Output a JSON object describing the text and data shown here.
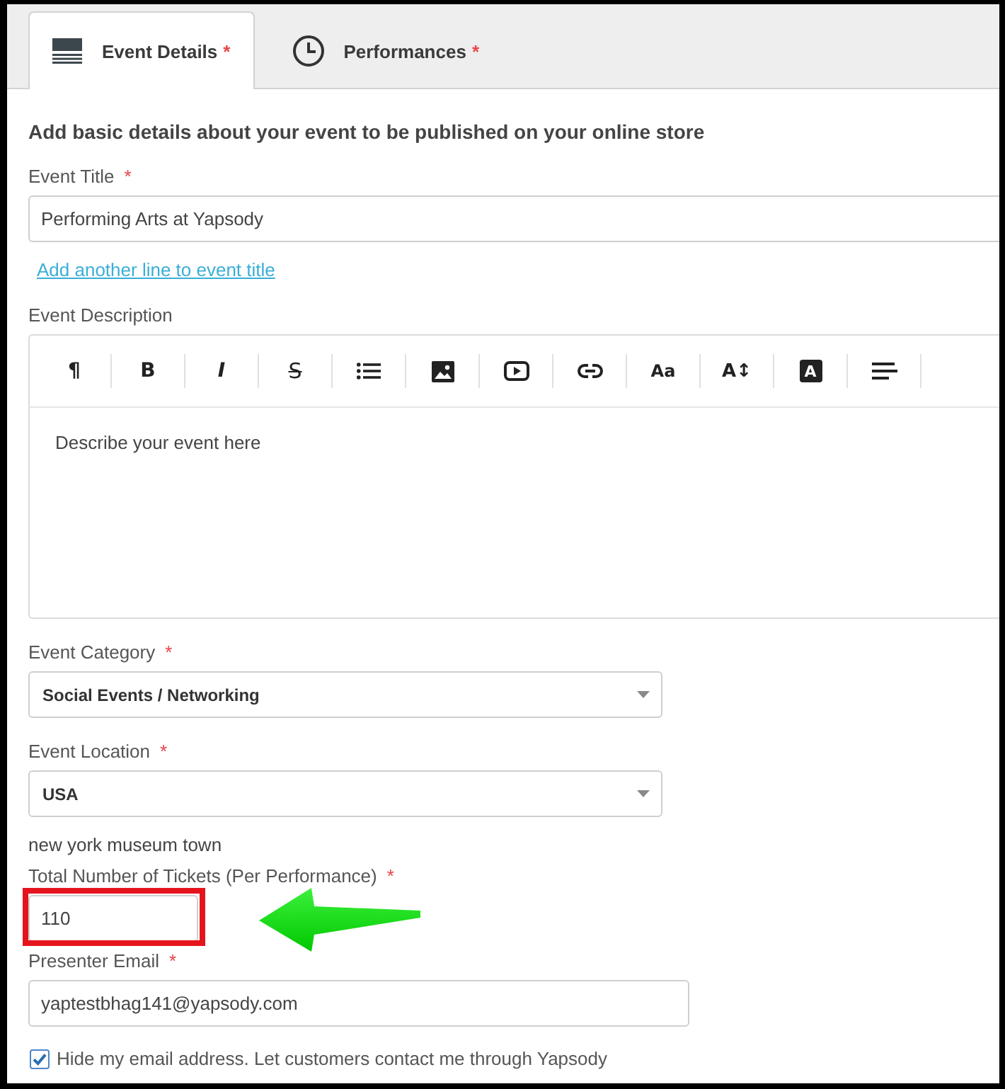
{
  "tabs": [
    {
      "kind": "details",
      "label": "Event Details",
      "mark": "*",
      "selected": true
    },
    {
      "kind": "clock",
      "label": "Performances",
      "mark": "*",
      "selected": false
    }
  ],
  "form": {
    "intro": "Add basic details about your event to be published on your online store",
    "items": [
      {
        "kind": "title",
        "label": "Event Title",
        "mark": "*",
        "value": "Performing Arts at Yapsody",
        "highlighted": false
      },
      {
        "kind": "link",
        "text": "Add another line to event title"
      },
      {
        "kind": "editor",
        "label": "Event Description",
        "toolbar": [
          {
            "kind": "paragraph",
            "text": "¶"
          },
          {
            "kind": "bold",
            "text": "B"
          },
          {
            "kind": "italic",
            "text": "I"
          },
          {
            "kind": "strike",
            "text": "S"
          },
          {
            "kind": "list"
          },
          {
            "kind": "image"
          },
          {
            "kind": "video"
          },
          {
            "kind": "link"
          },
          {
            "kind": "fontsize",
            "text": "Aa"
          },
          {
            "kind": "lineheight",
            "text": "A↕"
          },
          {
            "kind": "textcolor",
            "text": "A"
          },
          {
            "kind": "align"
          }
        ],
        "placeholder": "Describe your event here",
        "highlighted": false
      },
      {
        "kind": "select",
        "label": "Event Category",
        "mark": "*",
        "value": "Social Events / Networking",
        "highlighted": false
      },
      {
        "kind": "select",
        "label": "Event Location",
        "mark": "*",
        "value": "USA",
        "highlighted": false
      },
      {
        "kind": "note",
        "text": "new york museum town"
      },
      {
        "kind": "number",
        "label": "Total Number of Tickets (Per Performance)",
        "mark": "*",
        "value": "110",
        "highlighted": true
      },
      {
        "kind": "email",
        "label": "Presenter Email",
        "mark": "*",
        "value": "yaptestbhag141@yapsody.com",
        "highlighted": false
      },
      {
        "kind": "checkbox",
        "label": "Hide my email address. Let customers contact me through Yapsody",
        "checked": true
      }
    ]
  }
}
